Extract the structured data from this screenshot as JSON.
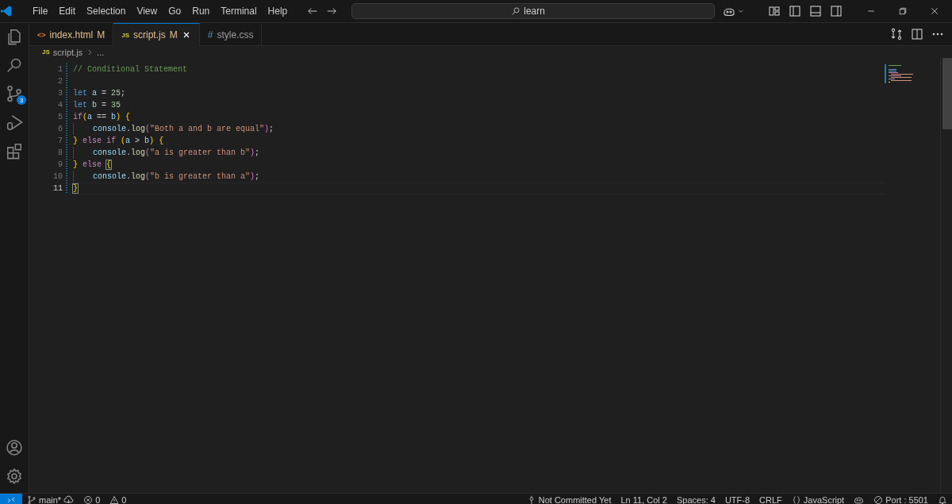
{
  "menu": [
    "File",
    "Edit",
    "Selection",
    "View",
    "Go",
    "Run",
    "Terminal",
    "Help"
  ],
  "search": {
    "value": "learn"
  },
  "activity": [
    {
      "kind": "files"
    },
    {
      "kind": "search"
    },
    {
      "kind": "git",
      "badge": "3"
    },
    {
      "kind": "run"
    },
    {
      "kind": "extensions"
    }
  ],
  "activity_bottom": [
    {
      "kind": "account"
    },
    {
      "kind": "settings"
    }
  ],
  "tabs": [
    {
      "kind": "html",
      "icon": "<>",
      "label": "index.html",
      "status": "M",
      "selected": false
    },
    {
      "kind": "js",
      "icon": "JS",
      "label": "script.js",
      "status": "M",
      "selected": true
    },
    {
      "kind": "css",
      "icon": "#",
      "label": "style.css",
      "selected": false
    }
  ],
  "breadcrumb": {
    "icon": "JS",
    "file": "script.js",
    "rest": "..."
  },
  "lines": [
    {
      "number": "1",
      "active": false,
      "modified": true,
      "indented": false,
      "tokens": [
        {
          "kind": "comment",
          "text": "// Conditional Statement"
        }
      ]
    },
    {
      "number": "2",
      "active": false,
      "modified": true,
      "indented": false
    },
    {
      "number": "3",
      "active": false,
      "modified": true,
      "indented": false,
      "tokens": [
        {
          "kind": "keyword",
          "text": "let"
        },
        {
          "kind": "variable",
          "text": " a"
        },
        {
          "kind": "plain",
          "text": " = "
        },
        {
          "kind": "number",
          "text": "25"
        },
        {
          "kind": "plain",
          "text": ";"
        }
      ]
    },
    {
      "number": "4",
      "active": false,
      "modified": true,
      "indented": false,
      "tokens": [
        {
          "kind": "keyword",
          "text": "let"
        },
        {
          "kind": "variable",
          "text": " b"
        },
        {
          "kind": "plain",
          "text": " = "
        },
        {
          "kind": "number",
          "text": "35"
        }
      ]
    },
    {
      "number": "5",
      "active": false,
      "modified": true,
      "indented": false,
      "tokens": [
        {
          "kind": "control",
          "text": "if"
        },
        {
          "kind": "gold",
          "text": "("
        },
        {
          "kind": "variable",
          "text": "a"
        },
        {
          "kind": "plain",
          "text": " == "
        },
        {
          "kind": "variable",
          "text": "b"
        },
        {
          "kind": "gold",
          "text": ")"
        },
        {
          "kind": "gold",
          "text": " {"
        }
      ]
    },
    {
      "number": "6",
      "active": false,
      "modified": true,
      "indented": true,
      "tokens": [
        {
          "kind": "variable",
          "text": "console"
        },
        {
          "kind": "plain",
          "text": "."
        },
        {
          "kind": "function",
          "text": "log"
        },
        {
          "kind": "purple",
          "text": "("
        },
        {
          "kind": "string",
          "text": "\"Both a and b are equal\""
        },
        {
          "kind": "purple",
          "text": ")"
        },
        {
          "kind": "plain",
          "text": ";"
        }
      ]
    },
    {
      "number": "7",
      "active": false,
      "modified": true,
      "indented": false,
      "tokens": [
        {
          "kind": "gold",
          "text": "}"
        },
        {
          "kind": "control",
          "text": " else"
        },
        {
          "kind": "control",
          "text": " if"
        },
        {
          "kind": "gold",
          "text": " ("
        },
        {
          "kind": "variable",
          "text": "a"
        },
        {
          "kind": "plain",
          "text": " > "
        },
        {
          "kind": "variable",
          "text": "b"
        },
        {
          "kind": "gold",
          "text": ")"
        },
        {
          "kind": "gold",
          "text": " {"
        }
      ]
    },
    {
      "number": "8",
      "active": false,
      "modified": true,
      "indented": true,
      "tokens": [
        {
          "kind": "variable",
          "text": "console"
        },
        {
          "kind": "plain",
          "text": "."
        },
        {
          "kind": "function",
          "text": "log"
        },
        {
          "kind": "purple",
          "text": "("
        },
        {
          "kind": "string",
          "text": "\"a is greater than b\""
        },
        {
          "kind": "purple",
          "text": ")"
        },
        {
          "kind": "plain",
          "text": ";"
        }
      ]
    },
    {
      "number": "9",
      "active": false,
      "modified": true,
      "indented": false,
      "tokens": [
        {
          "kind": "gold",
          "text": "}"
        },
        {
          "kind": "control",
          "text": " else"
        },
        {
          "kind": "gold-matched",
          "spaced": true,
          "text": "{"
        }
      ]
    },
    {
      "number": "10",
      "active": false,
      "modified": true,
      "indented": true,
      "tokens": [
        {
          "kind": "variable",
          "text": "console"
        },
        {
          "kind": "plain",
          "text": "."
        },
        {
          "kind": "function",
          "text": "log"
        },
        {
          "kind": "purple",
          "text": "("
        },
        {
          "kind": "string",
          "text": "\"b is greater than a\""
        },
        {
          "kind": "purple",
          "text": ")"
        },
        {
          "kind": "plain",
          "text": ";"
        }
      ]
    },
    {
      "number": "11",
      "active": true,
      "modified": true,
      "indented": false,
      "tokens": [
        {
          "kind": "gold-matched",
          "text": "}"
        }
      ]
    }
  ],
  "status_left": [
    {
      "kind": "branch",
      "text": "main*"
    },
    {
      "kind": "errors",
      "text": "0"
    },
    {
      "kind": "warnings",
      "text": "0"
    }
  ],
  "status_right": [
    {
      "kind": "commit",
      "text": "Not Committed Yet"
    },
    {
      "kind": "plain",
      "text": "Ln 11, Col 2"
    },
    {
      "kind": "plain",
      "text": "Spaces: 4"
    },
    {
      "kind": "plain",
      "text": "UTF-8"
    },
    {
      "kind": "plain",
      "text": "CRLF"
    },
    {
      "kind": "language",
      "text": "JavaScript"
    },
    {
      "kind": "copilot"
    },
    {
      "kind": "port",
      "text": "Port : 5501"
    },
    {
      "kind": "bell"
    }
  ]
}
